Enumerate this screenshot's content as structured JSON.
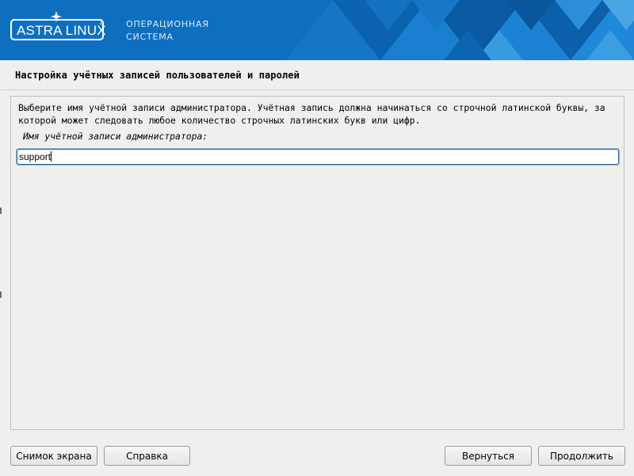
{
  "banner": {
    "logo_text": "ASTRA LINUX",
    "logo_registered": "®",
    "os_line1": "ОПЕРАЦИОННАЯ",
    "os_line2": "СИСТЕМА"
  },
  "page": {
    "title": "Настройка учётных записей пользователей и паролей",
    "description": "Выберите имя учётной записи администратора. Учётная запись должна начинаться со строчной латинской буквы, за которой может следовать любое количество строчных латинских букв или цифр.",
    "field_label": "Имя учётной записи администратора:",
    "field_value": "support"
  },
  "buttons": {
    "screenshot": "Снимок экрана",
    "help": "Справка",
    "back": "Вернуться",
    "continue": "Продолжить"
  },
  "colors": {
    "banner": "#0e6fc1",
    "input_focus": "#2c5f8f"
  }
}
